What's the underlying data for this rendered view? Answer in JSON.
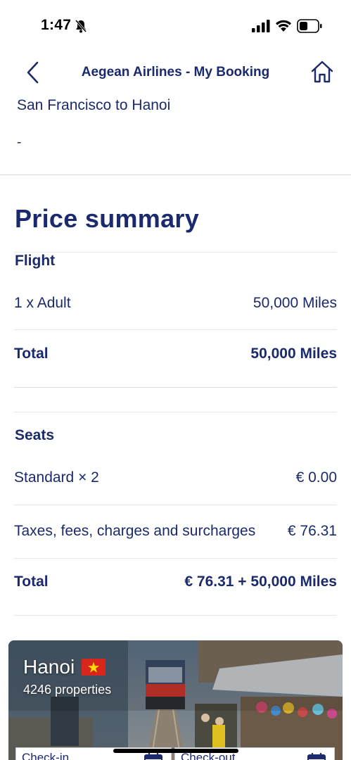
{
  "status_bar": {
    "time": "1:47"
  },
  "nav": {
    "title": "Aegean Airlines - My Booking"
  },
  "booking": {
    "route": "San Francisco to Hanoi",
    "subtitle": "-"
  },
  "price_summary": {
    "title": "Price summary",
    "flight": {
      "label": "Flight",
      "rows": [
        {
          "label": "1 x Adult",
          "value": "50,000 Miles"
        }
      ],
      "total_label": "Total",
      "total_value": "50,000 Miles"
    },
    "seats": {
      "label": "Seats",
      "rows": [
        {
          "label": "Standard × 2",
          "value": "€ 0.00"
        },
        {
          "label": "Taxes, fees, charges and surcharges",
          "value": "€ 76.31"
        }
      ],
      "total_label": "Total",
      "total_value": "€ 76.31 + 50,000 Miles"
    }
  },
  "hotel_card": {
    "city": "Hanoi",
    "properties": "4246 properties",
    "checkin_label": "Check-in",
    "checkout_label": "Check-out"
  },
  "colors": {
    "brand_navy": "#1a2a6c",
    "divider": "#e6e8ee"
  }
}
